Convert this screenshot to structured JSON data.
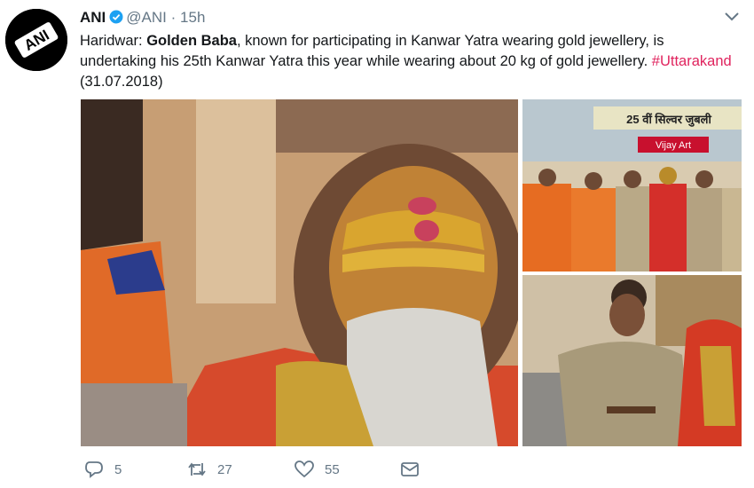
{
  "tweet": {
    "account_name": "ANI",
    "handle": "@ANI",
    "separator": "·",
    "time": "15h",
    "avatar_text": "ANI",
    "text_prefix": "Haridwar: ",
    "text_bold": "Golden Baba",
    "text_body": ", known for participating in Kanwar Yatra wearing gold jewellery, is undertaking his 25th Kanwar Yatra this year while wearing about 20 kg of gold jewellery. ",
    "hashtag": "#Uttarakand",
    "text_suffix": " (31.07.2018)"
  },
  "media": {
    "photo_2_signs": [
      "25 वीं सिल्वर जुबली",
      "Vijay Art"
    ]
  },
  "actions": {
    "replies": "5",
    "retweets": "27",
    "likes": "55"
  },
  "colors": {
    "text": "#14171a",
    "secondary": "#657786",
    "hashtag": "#e0245e",
    "verified": "#1da1f2"
  },
  "icons": [
    "verified-icon",
    "chevron-down-icon",
    "reply-icon",
    "retweet-icon",
    "like-icon",
    "message-icon"
  ]
}
